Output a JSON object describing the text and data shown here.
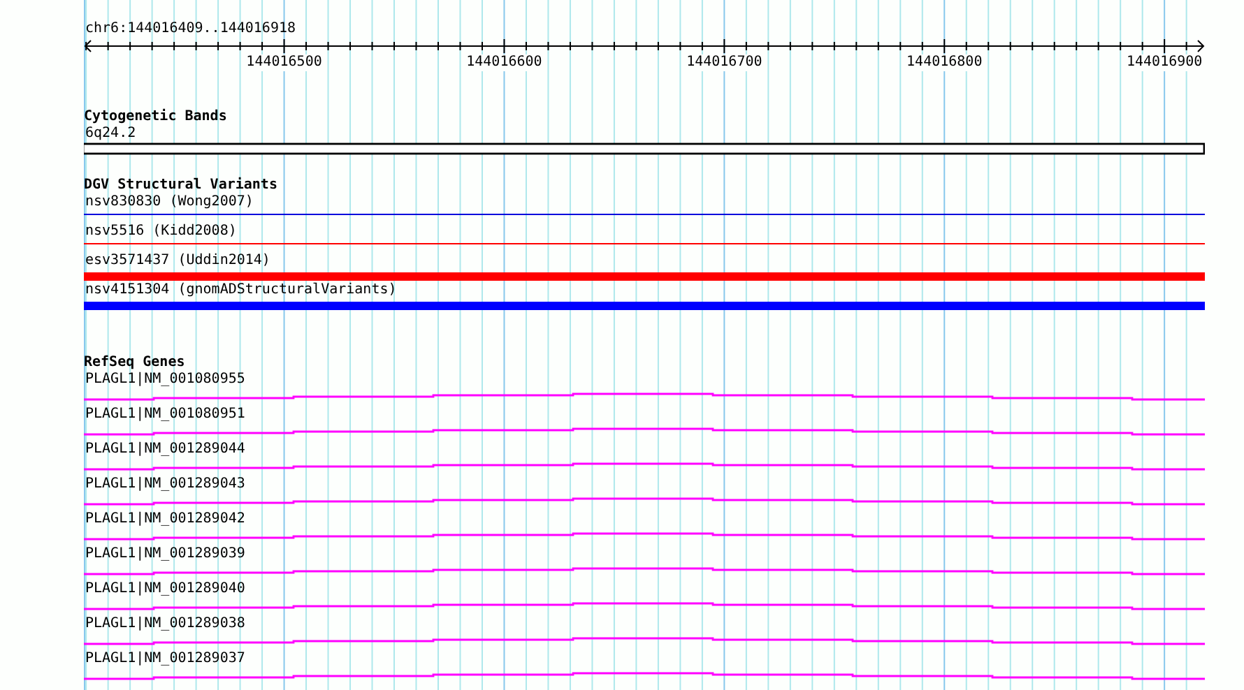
{
  "location": "chr6:144016409..144016918",
  "ruler": {
    "ticks": [
      "144016500",
      "144016600",
      "144016700",
      "144016800",
      "144016900"
    ]
  },
  "tracks": [
    {
      "title": "Cytogenetic Bands",
      "kind": "bands",
      "features": [
        {
          "label": "6q24.2",
          "color": "#ffffff"
        }
      ]
    },
    {
      "title": "DGV Structural Variants",
      "kind": "variants",
      "features": [
        {
          "label": "nsv830830 (Wong2007)",
          "kind": "thin",
          "color": "#0000dd"
        },
        {
          "label": "nsv5516 (Kidd2008)",
          "kind": "thin",
          "color": "#ff0000"
        },
        {
          "label": "esv3571437 (Uddin2014)",
          "kind": "thick",
          "color": "#ff0000"
        },
        {
          "label": "nsv4151304 (gnomADStructuralVariants)",
          "kind": "thick",
          "color": "#0000ff"
        }
      ]
    },
    {
      "title": "RefSeq Genes",
      "kind": "genes",
      "features": [
        {
          "label": "PLAGL1|NM_001080955",
          "color": "#ff00ff"
        },
        {
          "label": "PLAGL1|NM_001080951",
          "color": "#ff00ff"
        },
        {
          "label": "PLAGL1|NM_001289044",
          "color": "#ff00ff"
        },
        {
          "label": "PLAGL1|NM_001289043",
          "color": "#ff00ff"
        },
        {
          "label": "PLAGL1|NM_001289042",
          "color": "#ff00ff"
        },
        {
          "label": "PLAGL1|NM_001289039",
          "color": "#ff00ff"
        },
        {
          "label": "PLAGL1|NM_001289040",
          "color": "#ff00ff"
        },
        {
          "label": "PLAGL1|NM_001289038",
          "color": "#ff00ff"
        },
        {
          "label": "PLAGL1|NM_001289037",
          "color": "#ff00ff"
        }
      ]
    }
  ]
}
